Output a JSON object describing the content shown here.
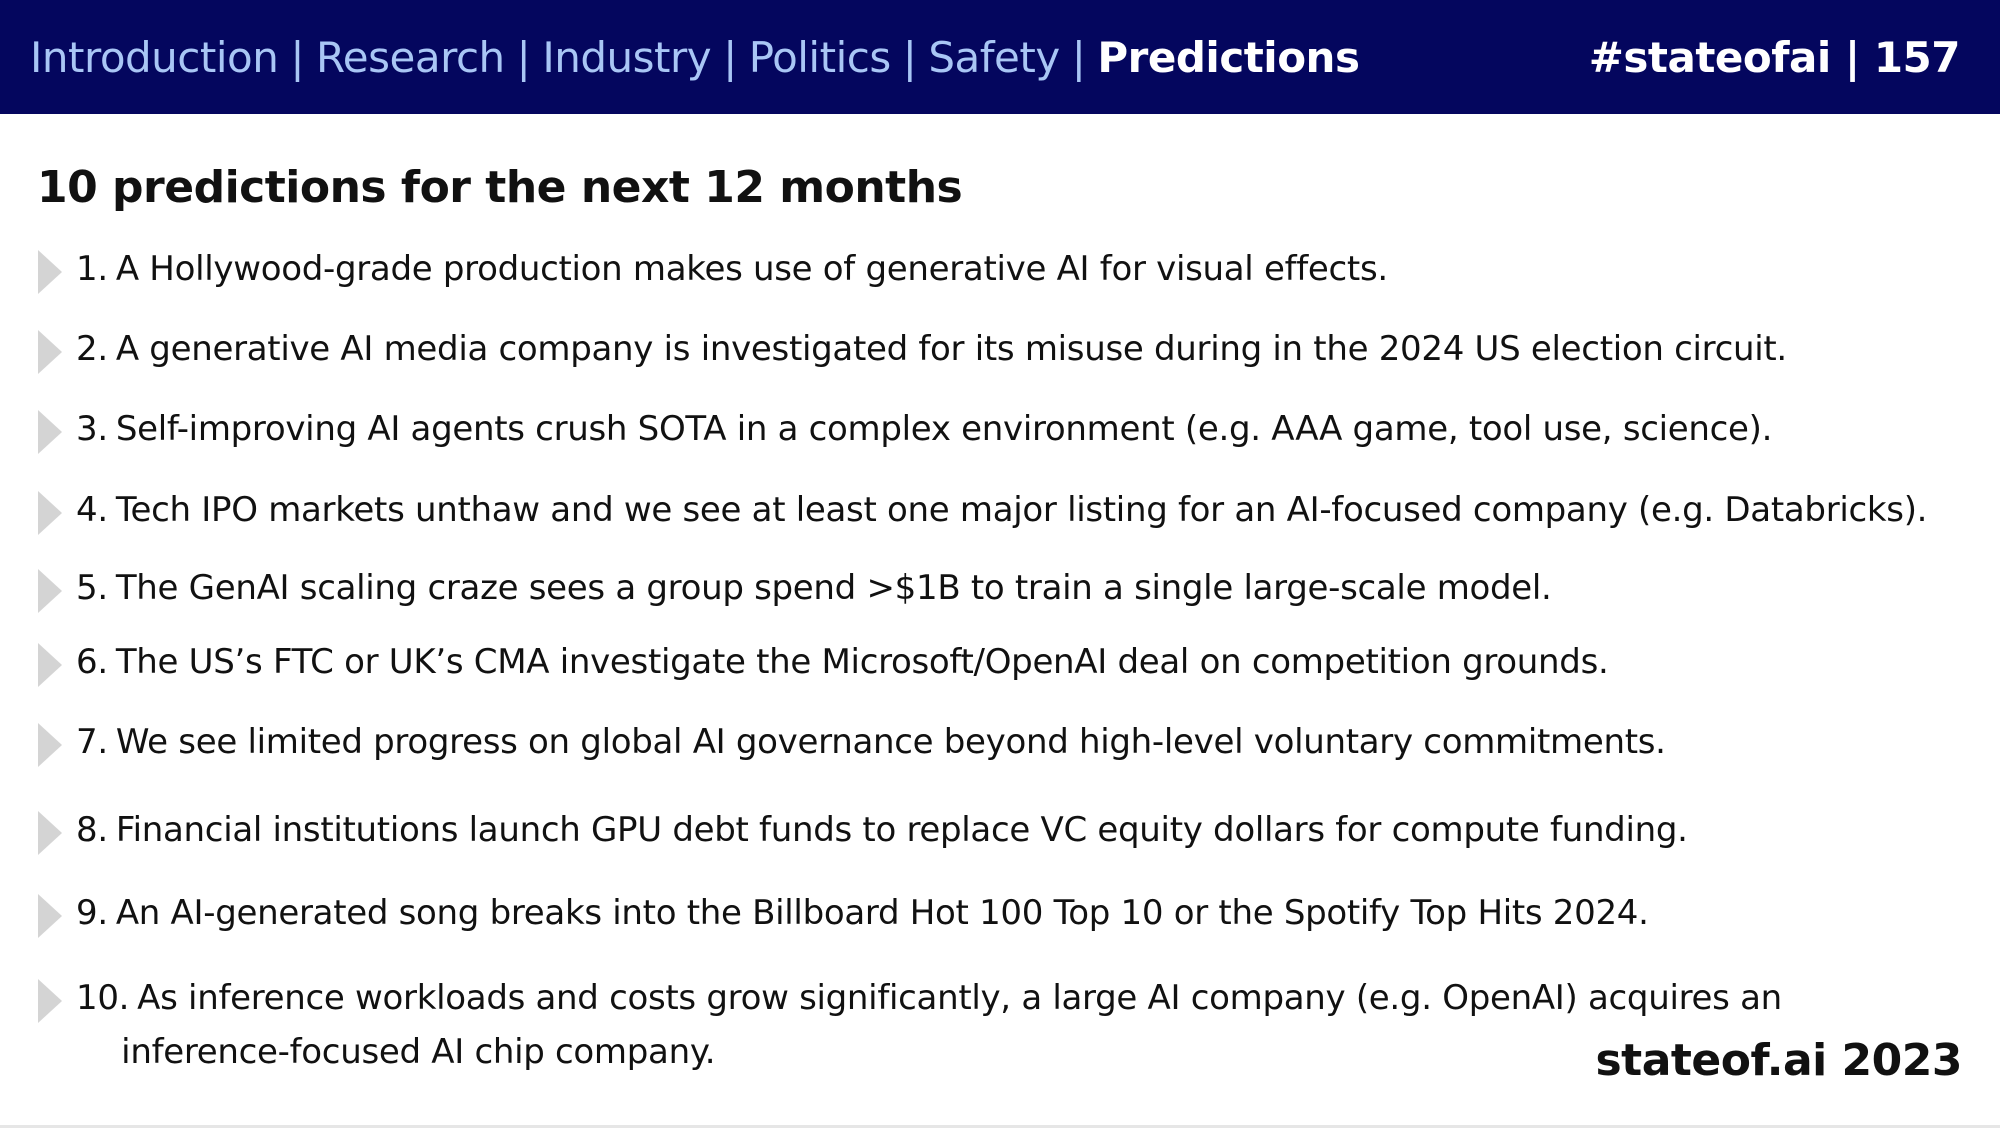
{
  "header": {
    "nav": [
      {
        "label": "Introduction",
        "active": false
      },
      {
        "label": "Research",
        "active": false
      },
      {
        "label": "Industry",
        "active": false
      },
      {
        "label": "Politics",
        "active": false
      },
      {
        "label": "Safety",
        "active": false
      },
      {
        "label": "Predictions",
        "active": true
      }
    ],
    "separator": "|",
    "hashtag_page": "#stateofai | 157"
  },
  "title": "10 predictions for the next 12 months",
  "predictions": [
    {
      "num": "1.",
      "text": "A Hollywood-grade production makes use of generative AI for visual effects."
    },
    {
      "num": "2.",
      "text": "A generative AI media company is investigated for its misuse during in the 2024 US election circuit."
    },
    {
      "num": "3.",
      "text": "Self-improving AI agents crush SOTA in a complex environment (e.g. AAA game, tool use, science)."
    },
    {
      "num": "4.",
      "text": "Tech IPO markets unthaw and we see at least one major listing for an AI-focused company (e.g. Databricks)."
    },
    {
      "num": "5.",
      "text": "The GenAI scaling craze sees a group spend >$1B to train a single large-scale model."
    },
    {
      "num": "6.",
      "text": "The US’s FTC or UK’s CMA investigate the Microsoft/OpenAI deal on competition grounds."
    },
    {
      "num": "7.",
      "text": "We see limited progress on global AI governance beyond high-level voluntary commitments."
    },
    {
      "num": "8.",
      "text": "Financial institutions launch GPU debt funds to replace VC equity dollars for compute funding."
    },
    {
      "num": "9.",
      "text": "An AI-generated song breaks into the Billboard Hot 100 Top 10 or the Spotify Top Hits 2024."
    },
    {
      "num": "10.",
      "text": "As inference workloads and costs grow significantly, a large AI company (e.g. OpenAI) acquires an",
      "text2": "inference-focused AI chip company."
    }
  ],
  "footer": "stateof.ai 2023",
  "colors": {
    "header_bg": "#04065e",
    "nav_inactive": "#a9c6f5",
    "nav_active": "#ffffff",
    "bullet": "#d4d4d4"
  }
}
